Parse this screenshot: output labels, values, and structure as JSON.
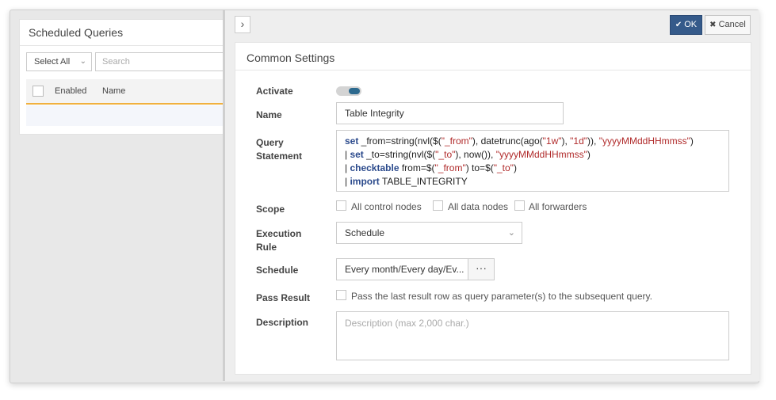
{
  "background_panel": {
    "title": "Scheduled Queries",
    "select_all": "Select All",
    "search_placeholder": "Search",
    "columns": [
      "Enabled",
      "Name"
    ]
  },
  "toolbar": {
    "ok_label": "OK",
    "cancel_label": "Cancel",
    "ok_icon": "check-icon",
    "cancel_icon": "close-icon",
    "collapse_icon": "chevron-right-icon"
  },
  "form": {
    "section_title": "Common Settings",
    "activate": {
      "label": "Activate",
      "on": true
    },
    "name": {
      "label": "Name",
      "value": "Table Integrity"
    },
    "query": {
      "label_line1": "Query",
      "label_line2": "Statement",
      "lines": [
        [
          {
            "t": "set",
            "c": "kw"
          },
          {
            "t": " _from=string(nvl($(",
            "c": ""
          },
          {
            "t": "\"_from\"",
            "c": "str"
          },
          {
            "t": "), datetrunc(ago(",
            "c": ""
          },
          {
            "t": "\"1w\"",
            "c": "str"
          },
          {
            "t": "), ",
            "c": ""
          },
          {
            "t": "\"1d\"",
            "c": "str"
          },
          {
            "t": ")), ",
            "c": ""
          },
          {
            "t": "\"yyyyMMddHHmmss\"",
            "c": "str"
          },
          {
            "t": ")",
            "c": ""
          }
        ],
        [
          {
            "t": "| ",
            "c": ""
          },
          {
            "t": "set",
            "c": "kw"
          },
          {
            "t": " _to=string(nvl($(",
            "c": ""
          },
          {
            "t": "\"_to\"",
            "c": "str"
          },
          {
            "t": "), now()), ",
            "c": ""
          },
          {
            "t": "\"yyyyMMddHHmmss\"",
            "c": "str"
          },
          {
            "t": ")",
            "c": ""
          }
        ],
        [
          {
            "t": "| ",
            "c": ""
          },
          {
            "t": "checktable",
            "c": "kw"
          },
          {
            "t": " from=$(",
            "c": ""
          },
          {
            "t": "\"_from\"",
            "c": "str"
          },
          {
            "t": ") to=$(",
            "c": ""
          },
          {
            "t": "\"_to\"",
            "c": "str"
          },
          {
            "t": ")",
            "c": ""
          }
        ],
        [
          {
            "t": "| ",
            "c": ""
          },
          {
            "t": "import",
            "c": "kw"
          },
          {
            "t": " TABLE_INTEGRITY",
            "c": ""
          }
        ]
      ]
    },
    "scope": {
      "label": "Scope",
      "options": [
        {
          "label": "All control nodes",
          "checked": false
        },
        {
          "label": "All data nodes",
          "checked": false
        },
        {
          "label": "All forwarders",
          "checked": false
        }
      ]
    },
    "execution_rule": {
      "label_line1": "Execution",
      "label_line2": "Rule",
      "value": "Schedule"
    },
    "schedule": {
      "label": "Schedule",
      "value": "Every month/Every day/Ev...",
      "button": "···"
    },
    "pass_result": {
      "label": "Pass Result",
      "text": "Pass the last result row as query parameter(s) to the subsequent query.",
      "checked": false
    },
    "description": {
      "label": "Description",
      "placeholder": "Description (max 2,000 char.)"
    }
  },
  "colors": {
    "primary": "#355a8a",
    "toggle_knob": "#2d6a8f",
    "keyword": "#2b4a8c",
    "string": "#b02a2a",
    "table_accent": "#f0b03e"
  }
}
